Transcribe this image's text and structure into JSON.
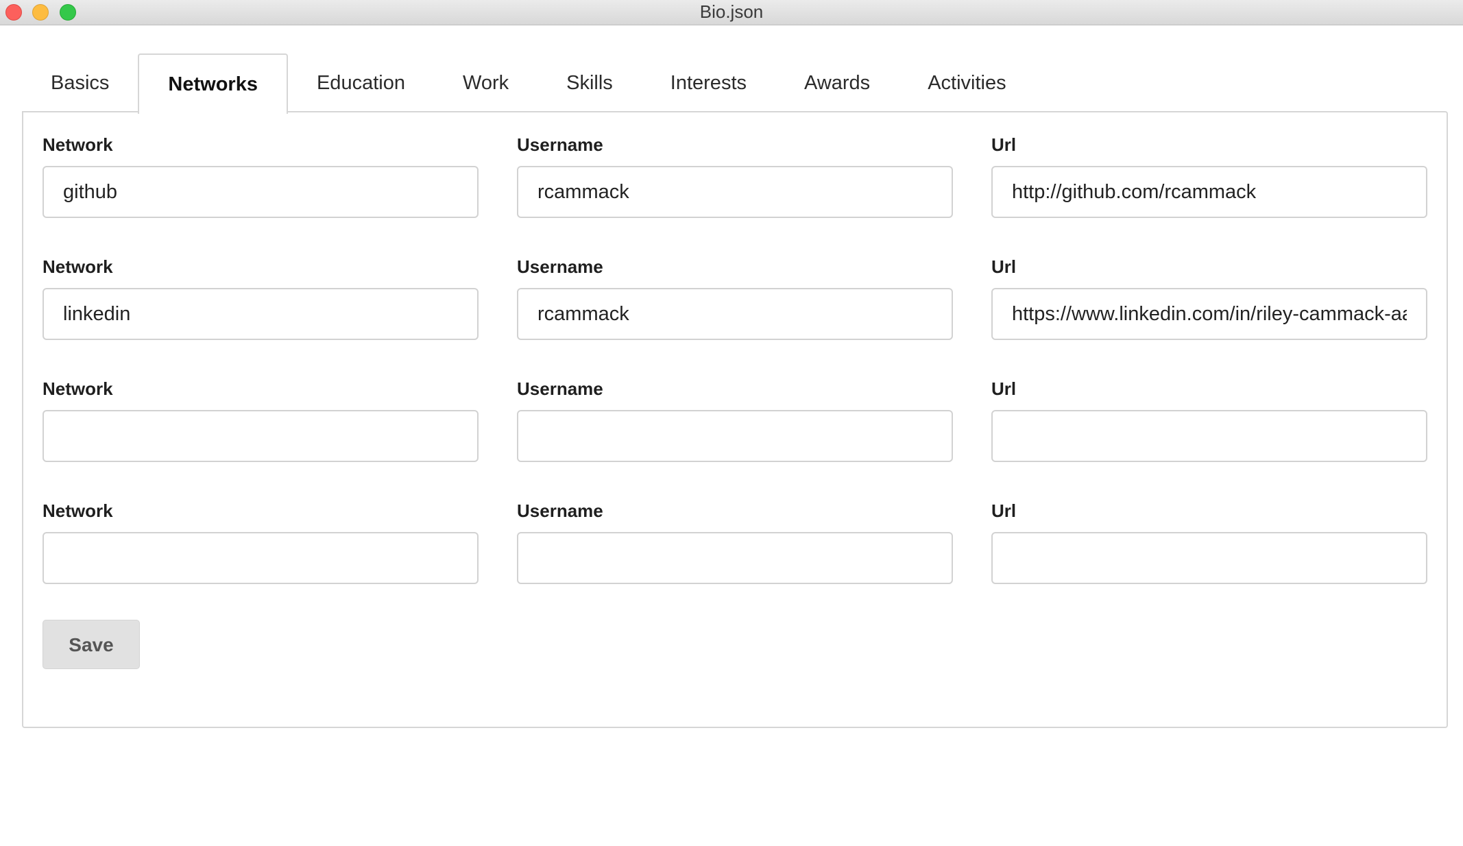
{
  "window": {
    "title": "Bio.json"
  },
  "tabs": [
    {
      "label": "Basics",
      "active": false
    },
    {
      "label": "Networks",
      "active": true
    },
    {
      "label": "Education",
      "active": false
    },
    {
      "label": "Work",
      "active": false
    },
    {
      "label": "Skills",
      "active": false
    },
    {
      "label": "Interests",
      "active": false
    },
    {
      "label": "Awards",
      "active": false
    },
    {
      "label": "Activities",
      "active": false
    }
  ],
  "labels": {
    "network": "Network",
    "username": "Username",
    "url": "Url"
  },
  "networks": [
    {
      "network": "github",
      "username": "rcammack",
      "url": "http://github.com/rcammack"
    },
    {
      "network": "linkedin",
      "username": "rcammack",
      "url": "https://www.linkedin.com/in/riley-cammack-aa"
    },
    {
      "network": "",
      "username": "",
      "url": ""
    },
    {
      "network": "",
      "username": "",
      "url": ""
    }
  ],
  "actions": {
    "save_label": "Save"
  },
  "colors": {
    "close": "#fc605c",
    "minimize": "#fdbc40",
    "maximize": "#34c84a",
    "save_bg": "#e1e1e1"
  }
}
